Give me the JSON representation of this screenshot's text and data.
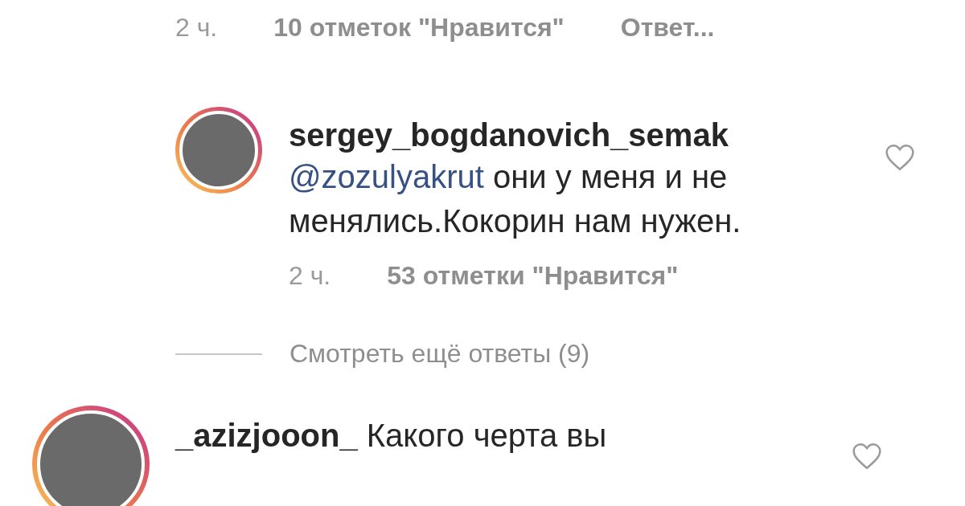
{
  "top_meta": {
    "time": "2 ч.",
    "likes": "10 отметок \"Нравится\"",
    "reply": "Ответ..."
  },
  "reply": {
    "username": "sergey_bogdanovich_semak",
    "mention": "@zozulyakrut",
    "text": " они у меня и не менялись.Кокорин нам нужен.",
    "time": "2 ч.",
    "likes": "53 отметки \"Нравится\"",
    "liked": false
  },
  "view_more": "Смотреть ещё ответы (9)",
  "comment": {
    "username": "_azizjooon_",
    "text": " Какого черта вы",
    "liked": false
  }
}
